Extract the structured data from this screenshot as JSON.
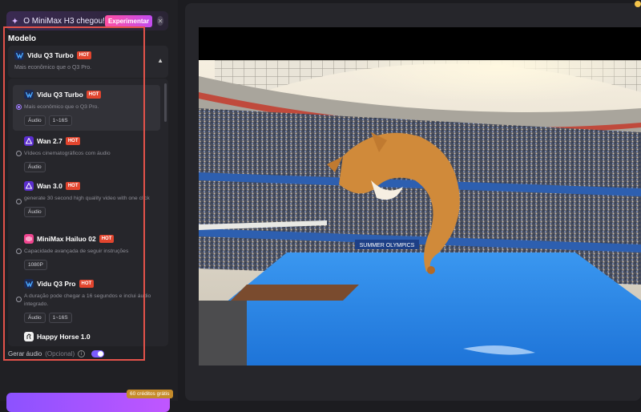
{
  "banner": {
    "text": "O MiniMax H3 chegou!",
    "cta": "Experimentar"
  },
  "model_section": {
    "label": "Modelo"
  },
  "selected": {
    "name": "Vidu Q3 Turbo",
    "badge": "HOT",
    "desc": "Mais econômico que o Q3 Pro."
  },
  "options": [
    {
      "name": "Vidu Q3 Turbo",
      "badge": "HOT",
      "desc": "Mais econômico que o Q3 Pro.",
      "tags": [
        "Áudio",
        "1~16S"
      ]
    },
    {
      "name": "Wan 2.7",
      "badge": "HOT",
      "desc": "Vídeos cinematográficos com áudio",
      "tags": [
        "Áudio"
      ]
    },
    {
      "name": "Wan 3.0",
      "badge": "HOT",
      "desc": "generate 30 second high quality video with one click",
      "tags": [
        "Áudio"
      ]
    },
    {
      "name": "MiniMax Hailuo 02",
      "badge": "HOT",
      "desc": "Capacidade avançada de seguir instruções",
      "tags": [
        "1080P"
      ]
    },
    {
      "name": "Vidu Q3 Pro",
      "badge": "HOT",
      "desc": "A duração pode chegar a 16 segundos e inclui áudio integrado.",
      "tags": [
        "Áudio",
        "1~16S"
      ]
    },
    {
      "name": "Happy Horse 1.0",
      "badge": "",
      "desc": "",
      "tags": []
    }
  ],
  "audio_option": {
    "label": "Gerar áudio",
    "optional": "(Opcional)",
    "enabled": true
  },
  "credits_badge": "60 créditos grátis",
  "scene": {
    "banner_text": "SUMMER OLYMPICS"
  },
  "colors": {
    "accent": "#7b5cff",
    "hot": "#e2452e",
    "highlight": "#e3524a"
  }
}
